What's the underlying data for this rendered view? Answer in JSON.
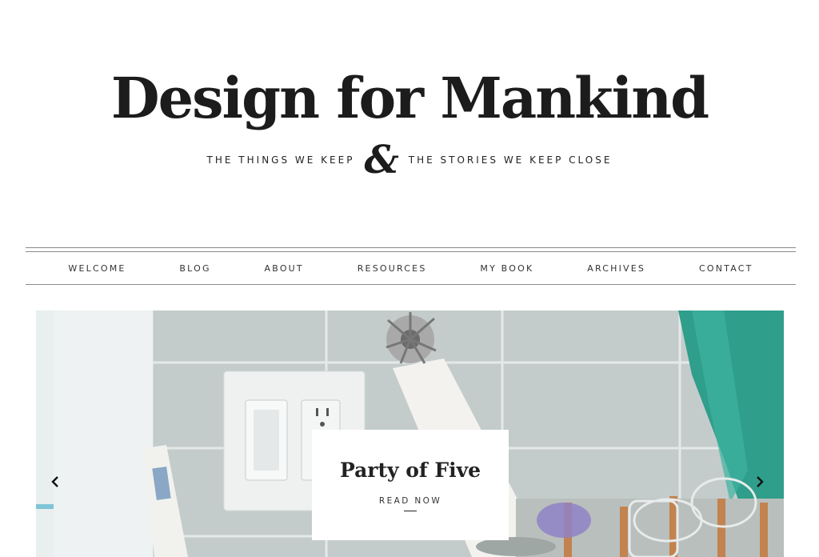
{
  "header": {
    "site_title": "Design for Mankind",
    "tagline_left": "THE THINGS WE KEEP",
    "tagline_amp": "&",
    "tagline_right": "THE STORIES WE KEEP CLOSE"
  },
  "nav": {
    "items": [
      {
        "label": "WELCOME"
      },
      {
        "label": "BLOG"
      },
      {
        "label": "ABOUT"
      },
      {
        "label": "RESOURCES"
      },
      {
        "label": "MY BOOK"
      },
      {
        "label": "ARCHIVES"
      },
      {
        "label": "CONTACT"
      }
    ]
  },
  "slider": {
    "caption_title": "Party of Five",
    "read_more_label": "READ NOW",
    "prev_icon": "chevron-left-icon",
    "next_icon": "chevron-right-icon"
  },
  "colors": {
    "text": "#1c1c1c",
    "rule": "#8a8a8a",
    "tile": "#c9d1d0",
    "curtain": "#2aa18c"
  }
}
